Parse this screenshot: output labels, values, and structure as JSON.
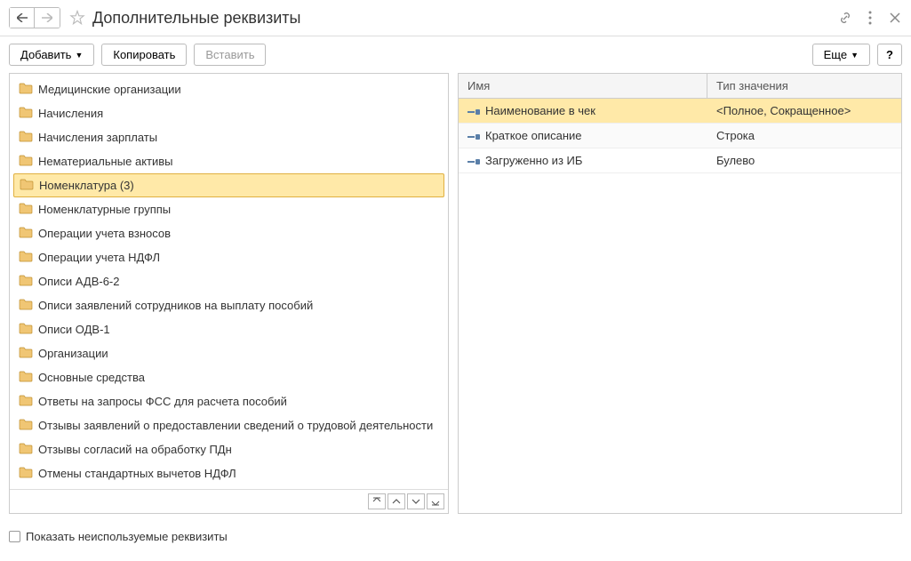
{
  "header": {
    "title": "Дополнительные реквизиты"
  },
  "toolbar": {
    "add": "Добавить",
    "copy": "Копировать",
    "paste": "Вставить",
    "more": "Еще",
    "help": "?"
  },
  "tree": [
    {
      "label": "Медицинские организации",
      "selected": false
    },
    {
      "label": "Начисления",
      "selected": false
    },
    {
      "label": "Начисления зарплаты",
      "selected": false
    },
    {
      "label": "Нематериальные активы",
      "selected": false
    },
    {
      "label": "Номенклатура (3)",
      "selected": true
    },
    {
      "label": "Номенклатурные группы",
      "selected": false
    },
    {
      "label": "Операции учета взносов",
      "selected": false
    },
    {
      "label": "Операции учета НДФЛ",
      "selected": false
    },
    {
      "label": "Описи АДВ-6-2",
      "selected": false
    },
    {
      "label": "Описи заявлений сотрудников на выплату пособий",
      "selected": false
    },
    {
      "label": "Описи ОДВ-1",
      "selected": false
    },
    {
      "label": "Организации",
      "selected": false
    },
    {
      "label": "Основные средства",
      "selected": false
    },
    {
      "label": "Ответы на запросы ФСС для расчета пособий",
      "selected": false
    },
    {
      "label": "Отзывы заявлений о предоставлении сведений о трудовой деятельности",
      "selected": false
    },
    {
      "label": "Отзывы согласий на обработку ПДн",
      "selected": false
    },
    {
      "label": "Отмены стандартных вычетов НДФЛ",
      "selected": false
    }
  ],
  "table": {
    "header": {
      "name": "Имя",
      "type": "Тип значения"
    },
    "rows": [
      {
        "name": "Наименование в чек",
        "type": "<Полное, Сокращенное>",
        "selected": true
      },
      {
        "name": "Краткое описание",
        "type": "Строка",
        "selected": false
      },
      {
        "name": "Загруженно из ИБ",
        "type": "Булево",
        "selected": false
      }
    ]
  },
  "footer": {
    "checkbox_label": "Показать неиспользуемые реквизиты"
  }
}
